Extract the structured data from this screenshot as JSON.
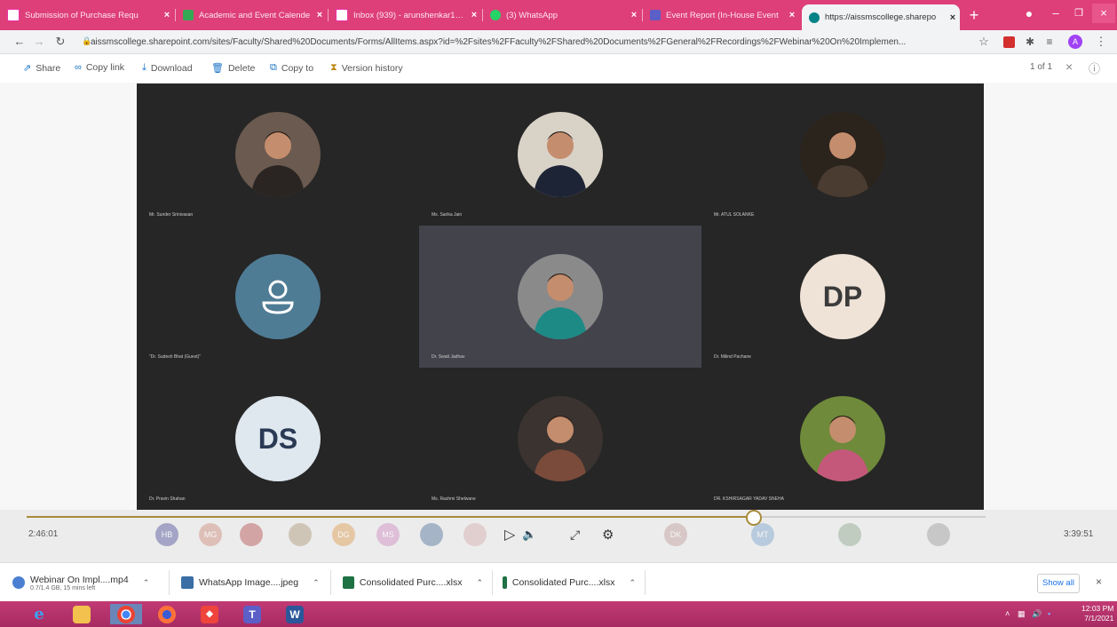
{
  "browser": {
    "tabs": [
      {
        "title": "Submission of Purchase Requ",
        "favicon": "gmail-icon",
        "color": "#ffffff"
      },
      {
        "title": "Academic and Event Calende",
        "favicon": "sheets-icon",
        "color": "#34a853"
      },
      {
        "title": "Inbox (939) - arunshenkar14@",
        "favicon": "gmail-icon",
        "color": "#ffffff"
      },
      {
        "title": "(3) WhatsApp",
        "favicon": "whatsapp-icon",
        "color": "#25d366"
      },
      {
        "title": "Event Report (In-House Event",
        "favicon": "forms-icon",
        "color": "#5b5fc7"
      },
      {
        "title": "https://aissmscollege.sharepo",
        "favicon": "sharepoint-icon",
        "color": "#038387"
      }
    ],
    "new_tab": "+",
    "window_controls": {
      "minimize": "–",
      "maximize": "❐",
      "close": "×"
    },
    "url": "aissmscollege.sharepoint.com/sites/Faculty/Shared%20Documents/Forms/AllItems.aspx?id=%2Fsites%2FFaculty%2FShared%20Documents%2FGeneral%2FRecordings%2FWebinar%20On%20Implemen...",
    "profile_initial": "A"
  },
  "commandbar": {
    "share": "Share",
    "copy_link": "Copy link",
    "download": "Download",
    "delete": "Delete",
    "copy_to": "Copy to",
    "version_history": "Version history",
    "page_info": "1 of 1"
  },
  "participants": [
    {
      "name": "Mr. Sunder Srinivasan",
      "kind": "photo",
      "bg": "#6b5a4f",
      "fg": "#2a2522"
    },
    {
      "name": "Ms. Sarika Jain",
      "kind": "photo",
      "bg": "#d9d2c7",
      "fg": "#1d2435"
    },
    {
      "name": "Mr. ATUL SOLANKE",
      "kind": "photo",
      "bg": "#2b241d",
      "fg": "#4a3c30"
    },
    {
      "name": "\"Dr. Sudesh Bhat (Guest)\"",
      "kind": "icon",
      "bg": "#4f7c95",
      "fg": "#ffffff"
    },
    {
      "name": "Dr. Swati Jadhav",
      "kind": "photo",
      "bg": "#8a8a8a",
      "fg": "#1e8a86"
    },
    {
      "name": "Dr. Milind Pachane",
      "kind": "initials",
      "initials": "DP",
      "bg": "#efe2d7",
      "fg": "#3b3b3b"
    },
    {
      "name": "Dr. Pravin Shahan",
      "kind": "initials",
      "initials": "DS",
      "bg": "#dfe7ef",
      "fg": "#2a3a55"
    },
    {
      "name": "Ms. Rashmi Shelwane",
      "kind": "photo",
      "bg": "#3a3330",
      "fg": "#7a4b3a"
    },
    {
      "name": "DR. KSHIRSAGAR YADAV SNEHA",
      "kind": "photo",
      "bg": "#6f8a3a",
      "fg": "#c4587a"
    }
  ],
  "player": {
    "elapsed": "2:46:01",
    "total": "3:39:51",
    "progress": 0.757,
    "strip": [
      {
        "label": "HB",
        "color": "#6a6aa8"
      },
      {
        "label": "MG",
        "color": "#d39c8e"
      },
      {
        "label": "",
        "color": "#c06a6a"
      },
      {
        "label": "",
        "color": "#b8a68c"
      },
      {
        "label": "DG",
        "color": "#e0a96b"
      },
      {
        "label": "MS",
        "color": "#d49ac9"
      },
      {
        "label": "",
        "color": "#6b87a8"
      },
      {
        "label": "",
        "color": "#d8b8b8"
      },
      {
        "label": "DK",
        "color": "#c9a9a9"
      },
      {
        "label": "MT",
        "color": "#8fb0d1"
      },
      {
        "label": "",
        "color": "#9bb39b"
      },
      {
        "label": "",
        "color": "#a9a9a9"
      }
    ]
  },
  "downloads": [
    {
      "name": "Webinar On Impl....mp4",
      "status": "0.7/1.4 GB, 15 mins left",
      "color": "#4a7fd1"
    },
    {
      "name": "WhatsApp Image....jpeg",
      "status": "",
      "color": "#3a6ea5"
    },
    {
      "name": "Consolidated Purc....xlsx",
      "status": "",
      "color": "#1f7244"
    },
    {
      "name": "Consolidated Purc....xlsx",
      "status": "",
      "color": "#1f7244"
    }
  ],
  "show_all": "Show all",
  "taskbar": {
    "time": "12:03 PM",
    "date": "7/1/2021"
  }
}
